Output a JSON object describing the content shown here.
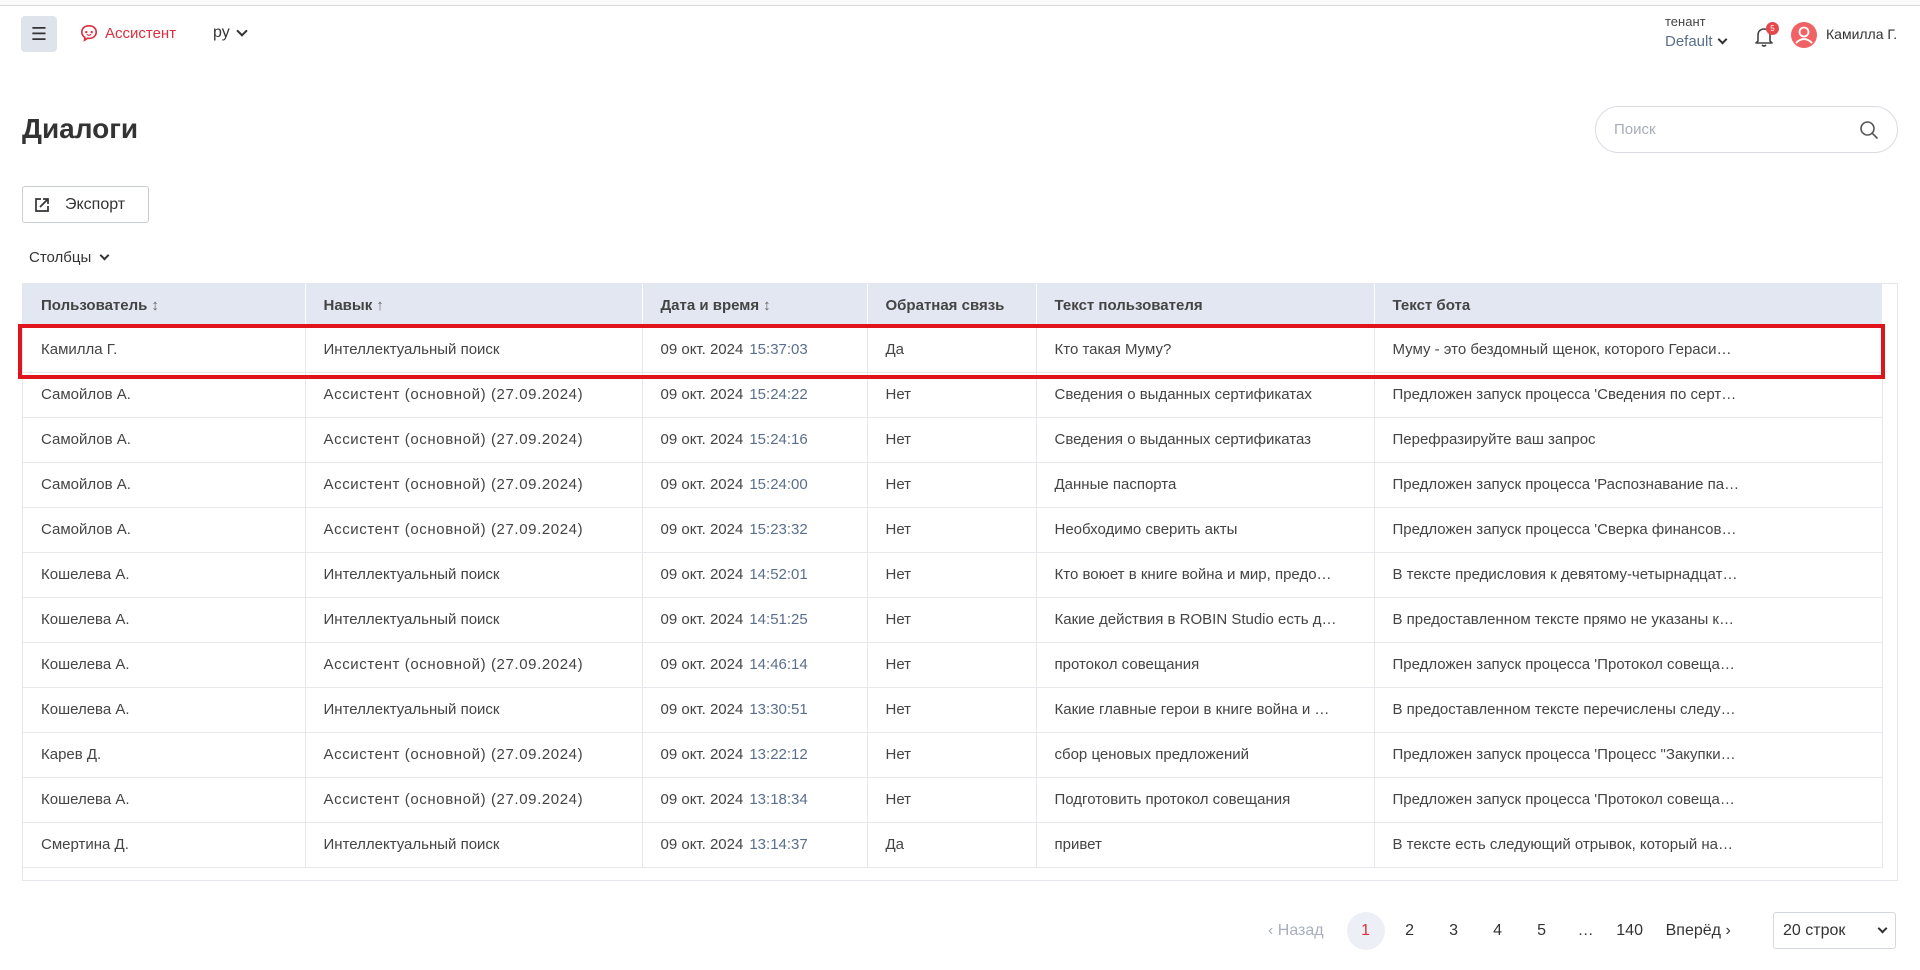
{
  "header": {
    "brand_name": "Ассистент",
    "language": "ру",
    "tenant_label": "тенант",
    "tenant_value": "Default",
    "notifications_count": "5",
    "user_name": "Камилла Г."
  },
  "page": {
    "title": "Диалоги",
    "search_placeholder": "Поиск",
    "export_label": "Экспорт",
    "columns_label": "Столбцы"
  },
  "table": {
    "headers": {
      "user": "Пользователь",
      "skill": "Навык",
      "datetime": "Дата и время",
      "feedback": "Обратная связь",
      "user_text": "Текст пользователя",
      "bot_text": "Текст бота"
    },
    "sort_icons": {
      "user": "↕",
      "skill": "↑",
      "datetime": "↕"
    },
    "rows": [
      {
        "user": "Камилла Г.",
        "skill": "Интеллектуальный поиск",
        "date": "09 окт. 2024",
        "time": "15:37:03",
        "feedback": "Да",
        "user_text": "Кто такая Муму?",
        "bot_text": "Муму - это бездомный щенок, которого Гераси…"
      },
      {
        "user": "Самойлов А.",
        "skill": "Ассистент (основной) (27.09.2024)",
        "date": "09 окт. 2024",
        "time": "15:24:22",
        "feedback": "Нет",
        "user_text": "Сведения о выданных сертификатах",
        "bot_text": "Предложен запуск процесса 'Сведения по серт…"
      },
      {
        "user": "Самойлов А.",
        "skill": "Ассистент (основной) (27.09.2024)",
        "date": "09 окт. 2024",
        "time": "15:24:16",
        "feedback": "Нет",
        "user_text": "Сведения о выданных сертификатаз",
        "bot_text": "Перефразируйте ваш запрос"
      },
      {
        "user": "Самойлов А.",
        "skill": "Ассистент (основной) (27.09.2024)",
        "date": "09 окт. 2024",
        "time": "15:24:00",
        "feedback": "Нет",
        "user_text": "Данные паспорта",
        "bot_text": "Предложен запуск процесса 'Распознавание па…"
      },
      {
        "user": "Самойлов А.",
        "skill": "Ассистент (основной) (27.09.2024)",
        "date": "09 окт. 2024",
        "time": "15:23:32",
        "feedback": "Нет",
        "user_text": "Необходимо сверить акты",
        "bot_text": "Предложен запуск процесса 'Сверка финансов…"
      },
      {
        "user": "Кошелева А.",
        "skill": "Интеллектуальный поиск",
        "date": "09 окт. 2024",
        "time": "14:52:01",
        "feedback": "Нет",
        "user_text": "Кто воюет в книге война и мир, предо…",
        "bot_text": "В тексте предисловия к девятому-четырнадцат…"
      },
      {
        "user": "Кошелева А.",
        "skill": "Интеллектуальный поиск",
        "date": "09 окт. 2024",
        "time": "14:51:25",
        "feedback": "Нет",
        "user_text": "Какие действия в ROBIN Studio есть д…",
        "bot_text": "В предоставленном тексте прямо не указаны к…"
      },
      {
        "user": "Кошелева А.",
        "skill": "Ассистент (основной) (27.09.2024)",
        "date": "09 окт. 2024",
        "time": "14:46:14",
        "feedback": "Нет",
        "user_text": "протокол совещания",
        "bot_text": "Предложен запуск процесса 'Протокол совеща…"
      },
      {
        "user": "Кошелева А.",
        "skill": "Интеллектуальный поиск",
        "date": "09 окт. 2024",
        "time": "13:30:51",
        "feedback": "Нет",
        "user_text": "Какие главные герои в книге война и …",
        "bot_text": "В предоставленном тексте перечислены следу…"
      },
      {
        "user": "Карев Д.",
        "skill": "Ассистент (основной) (27.09.2024)",
        "date": "09 окт. 2024",
        "time": "13:22:12",
        "feedback": "Нет",
        "user_text": "сбор ценовых предложений",
        "bot_text": "Предложен запуск процесса 'Процесс \"Закупки…"
      },
      {
        "user": "Кошелева А.",
        "skill": "Ассистент (основной) (27.09.2024)",
        "date": "09 окт. 2024",
        "time": "13:18:34",
        "feedback": "Нет",
        "user_text": "Подготовить протокол совещания",
        "bot_text": "Предложен запуск процесса 'Протокол совеща…"
      },
      {
        "user": "Смертина Д.",
        "skill": "Интеллектуальный поиск",
        "date": "09 окт. 2024",
        "time": "13:14:37",
        "feedback": "Да",
        "user_text": "привет",
        "bot_text": "В тексте есть следующий отрывок, который на…"
      }
    ]
  },
  "pagination": {
    "prev_label": "Назад",
    "next_label": "Вперёд",
    "pages": [
      "1",
      "2",
      "3",
      "4",
      "5"
    ],
    "ellipsis": "…",
    "last_page": "140",
    "current_page": "1",
    "rows_per_page": "20 строк"
  },
  "colors": {
    "accent": "#e0303c",
    "highlight_box": "#e0141c",
    "header_bg": "#e2e7f1",
    "time_text": "#5a6f8c"
  },
  "icons": {
    "menu": "menu-icon",
    "brand": "assistant-logo-icon",
    "bell": "bell-icon",
    "avatar": "user-avatar-icon",
    "search": "search-icon",
    "export": "export-icon"
  }
}
